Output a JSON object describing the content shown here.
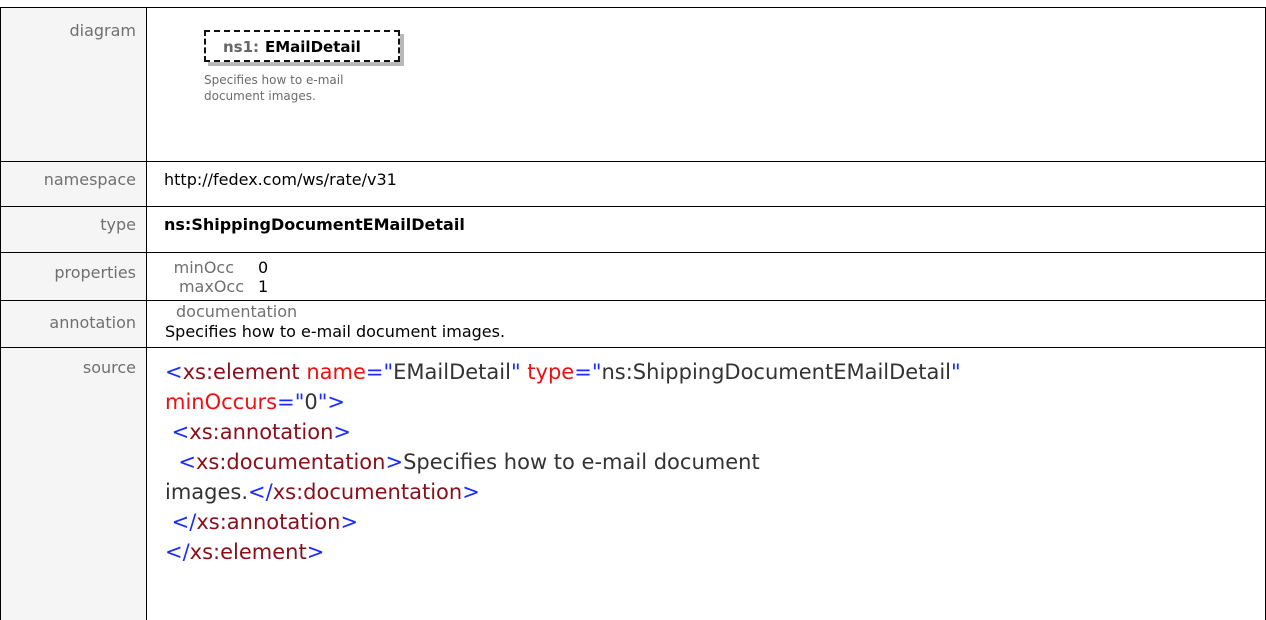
{
  "rows": {
    "diagram": {
      "label": "diagram",
      "element_prefix": "ns1:",
      "element_name": "EMailDetail",
      "element_doc": "Specifies how to e-mail document images."
    },
    "namespace": {
      "label": "namespace",
      "value": "http://fedex.com/ws/rate/v31"
    },
    "type": {
      "label": "type",
      "value": "ns:ShippingDocumentEMailDetail"
    },
    "properties": {
      "label": "properties",
      "items": [
        {
          "key": "minOcc",
          "value": "0"
        },
        {
          "key": "maxOcc",
          "value": "1"
        }
      ]
    },
    "annotation": {
      "label": "annotation",
      "key": "documentation",
      "value": "Specifies how to e-mail document images."
    },
    "source": {
      "label": "source",
      "lines": [
        [
          {
            "t": "<",
            "c": "punct"
          },
          {
            "t": "xs:element",
            "c": "tag"
          },
          {
            "t": " name",
            "c": "attr"
          },
          {
            "t": "=\"",
            "c": "punct"
          },
          {
            "t": "EMailDetail",
            "c": "text"
          },
          {
            "t": "\"",
            "c": "punct"
          },
          {
            "t": " type",
            "c": "attr"
          },
          {
            "t": "=\"",
            "c": "punct"
          },
          {
            "t": "ns:ShippingDocumentEMailDetail",
            "c": "text"
          },
          {
            "t": "\"",
            "c": "punct"
          }
        ],
        [
          {
            "t": "minOccurs",
            "c": "attr"
          },
          {
            "t": "=\"",
            "c": "punct"
          },
          {
            "t": "0",
            "c": "text"
          },
          {
            "t": "\">",
            "c": "punct"
          }
        ],
        [
          {
            "t": " <",
            "c": "punct"
          },
          {
            "t": "xs:annotation",
            "c": "tag"
          },
          {
            "t": ">",
            "c": "punct"
          }
        ],
        [
          {
            "t": "  <",
            "c": "punct"
          },
          {
            "t": "xs:documentation",
            "c": "tag"
          },
          {
            "t": ">",
            "c": "punct"
          },
          {
            "t": "Specifies how to e-mail document",
            "c": "text"
          }
        ],
        [
          {
            "t": "images.",
            "c": "text"
          },
          {
            "t": "</",
            "c": "punct"
          },
          {
            "t": "xs:documentation",
            "c": "tag"
          },
          {
            "t": ">",
            "c": "punct"
          }
        ],
        [
          {
            "t": " </",
            "c": "punct"
          },
          {
            "t": "xs:annotation",
            "c": "tag"
          },
          {
            "t": ">",
            "c": "punct"
          }
        ],
        [
          {
            "t": "</",
            "c": "punct"
          },
          {
            "t": "xs:element",
            "c": "tag"
          },
          {
            "t": ">",
            "c": "punct"
          }
        ]
      ]
    }
  }
}
